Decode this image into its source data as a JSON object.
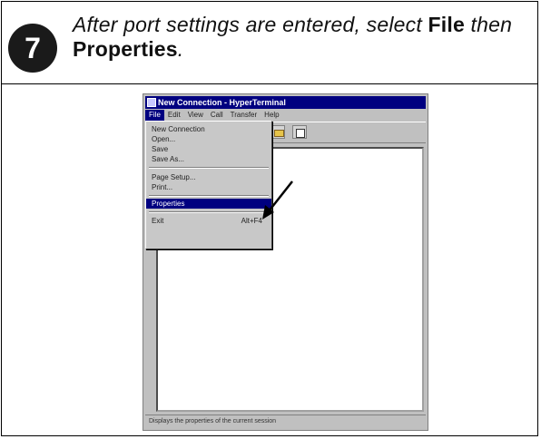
{
  "step": {
    "number": "7"
  },
  "instruction": {
    "part1": "After port settings are entered, select ",
    "file": "File",
    "part2": " then ",
    "properties": "Properties",
    "end": "."
  },
  "screenshot": {
    "title": "New Connection - HyperTerminal",
    "menu": [
      "File",
      "Edit",
      "View",
      "Call",
      "Transfer",
      "Help"
    ],
    "file_menu": [
      {
        "label": "New Connection",
        "accel": ""
      },
      {
        "label": "Open...",
        "accel": ""
      },
      {
        "label": "Save",
        "accel": ""
      },
      {
        "label": "Save As...",
        "accel": ""
      },
      {
        "label": "Page Setup...",
        "accel": ""
      },
      {
        "label": "Print...",
        "accel": ""
      },
      {
        "label": "Properties",
        "accel": ""
      },
      {
        "label": "Exit",
        "accel": "Alt+F4"
      }
    ],
    "status": "Displays the properties of the current session"
  },
  "colors": {
    "title_bar": "#000080",
    "selection": "#000080",
    "window": "#c0c0c0"
  },
  "icons": [
    "open-folder-icon",
    "properties-icon",
    "pointer-arrow-icon"
  ]
}
